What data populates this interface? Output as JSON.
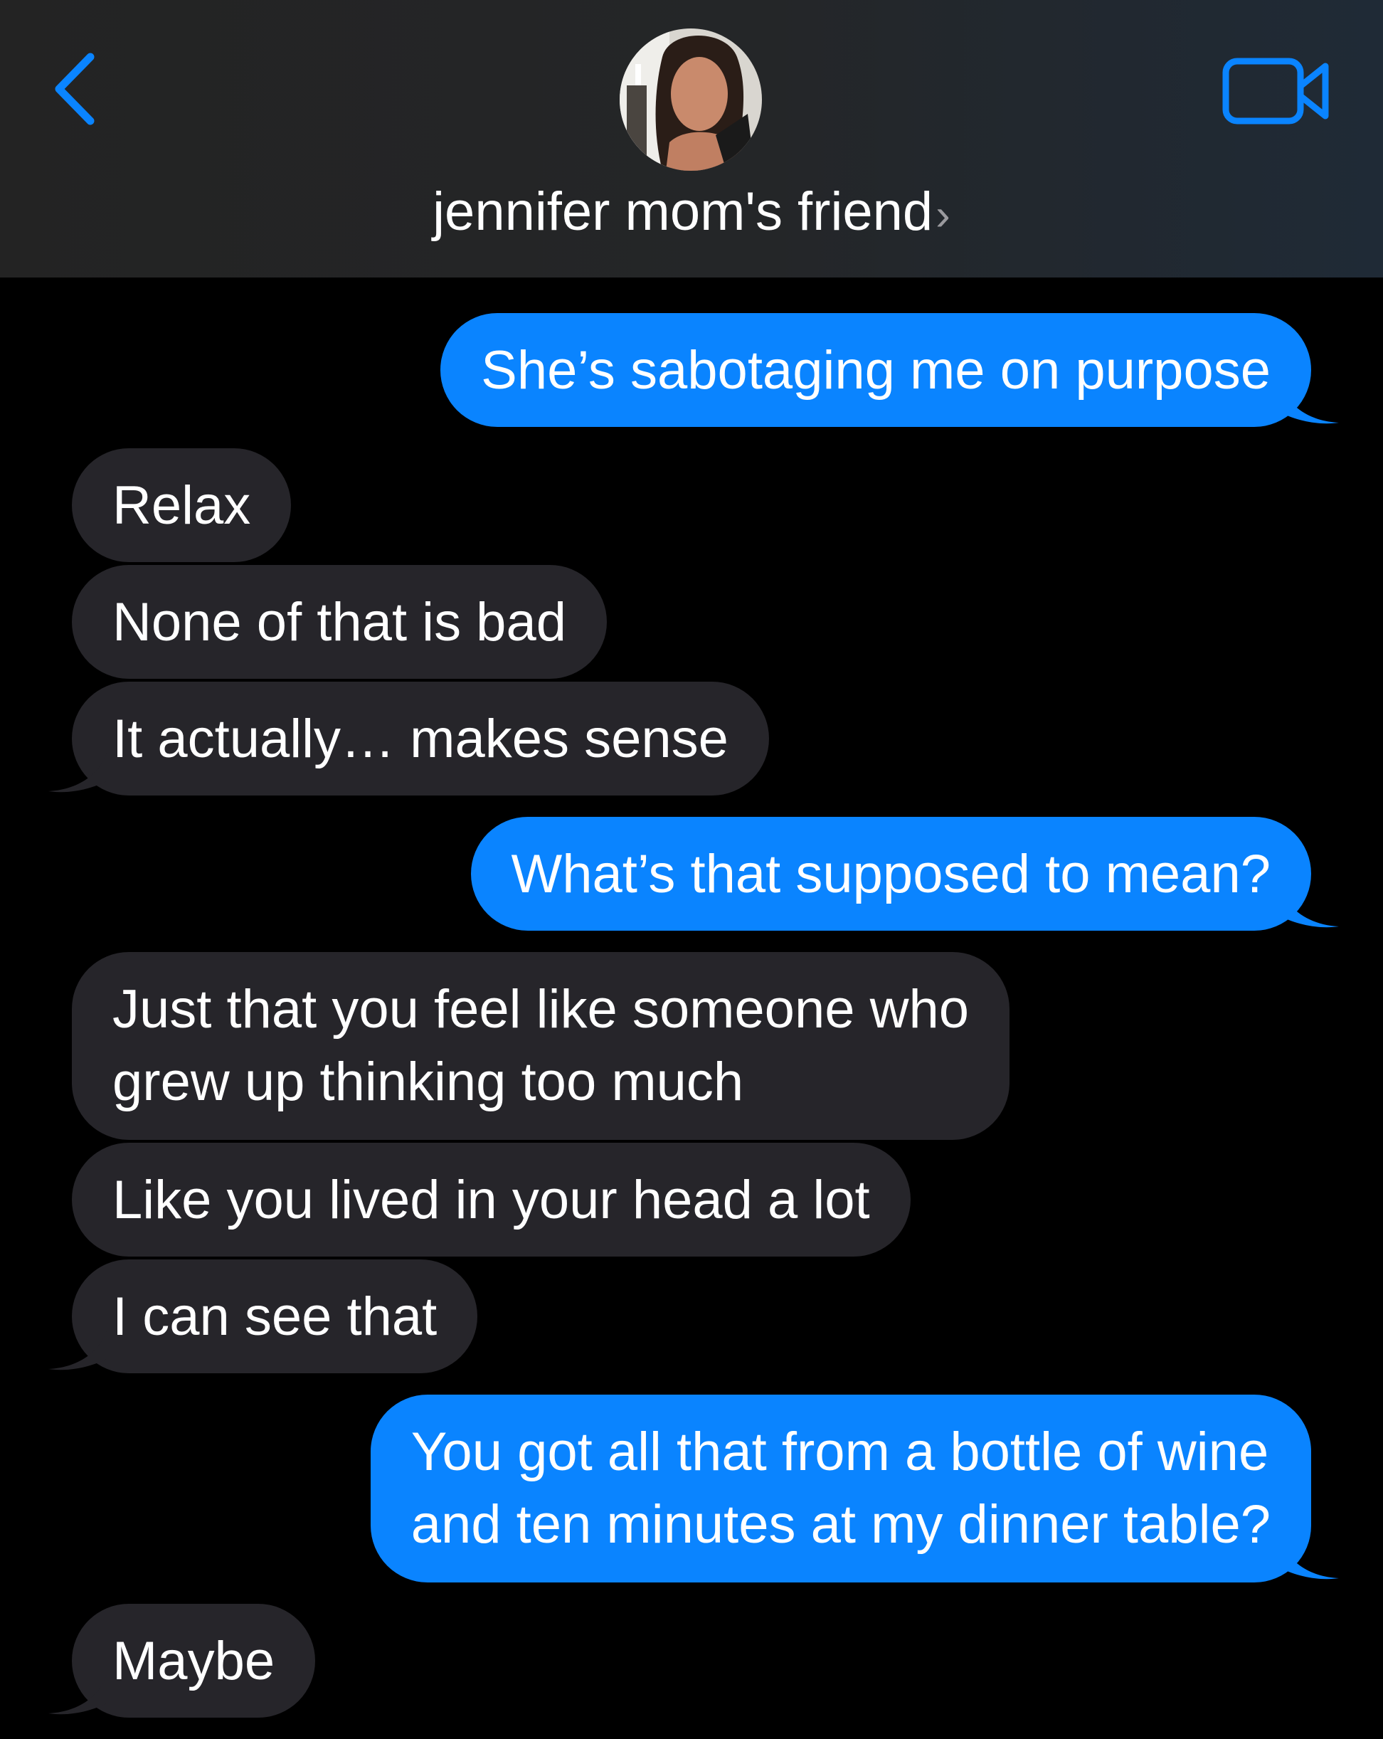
{
  "header": {
    "contact_name": "jennifer mom's friend",
    "chevron": "›",
    "back_icon": "chevron-left-icon",
    "video_icon": "video-camera-icon",
    "accent_color": "#0a84ff"
  },
  "messages": [
    {
      "from": "me",
      "text": "She’s sabotaging me on purpose"
    },
    {
      "from": "them",
      "text": "Relax"
    },
    {
      "from": "them",
      "text": "None of that is bad"
    },
    {
      "from": "them",
      "text": "It actually… makes sense"
    },
    {
      "from": "me",
      "text": "What’s that supposed to mean?"
    },
    {
      "from": "them",
      "line1": "Just that you feel like someone who",
      "line2": "grew up thinking too much"
    },
    {
      "from": "them",
      "text": "Like you lived in your head a lot"
    },
    {
      "from": "them",
      "text": "I can see that"
    },
    {
      "from": "me",
      "line1": "You got all that from a bottle of wine",
      "line2": "and ten minutes at my dinner table?"
    },
    {
      "from": "them",
      "text": "Maybe"
    }
  ],
  "colors": {
    "outgoing_bubble": "#0a84ff",
    "incoming_bubble": "#26252a",
    "background": "#000000"
  }
}
